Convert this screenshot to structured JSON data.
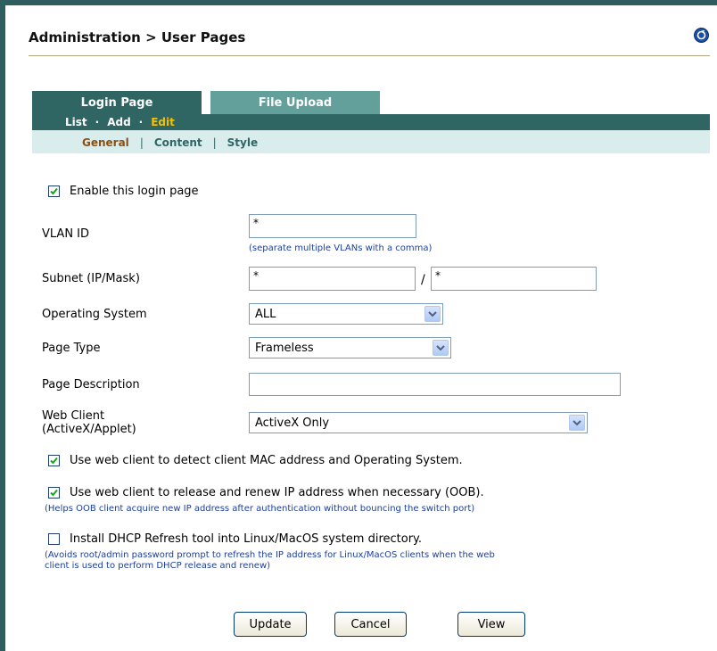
{
  "header": {
    "title": "Administration > User Pages"
  },
  "tabs": [
    {
      "label": "Login Page",
      "active": true
    },
    {
      "label": "File Upload",
      "active": false
    }
  ],
  "subnav": {
    "list": "List",
    "add": "Add",
    "edit": "Edit",
    "separator": "·"
  },
  "subsubnav": {
    "general": "General",
    "content": "Content",
    "style": "Style",
    "separator": "|"
  },
  "form": {
    "enable": {
      "label": "Enable this login page",
      "checked": true
    },
    "vlan": {
      "label": "VLAN ID",
      "value": "*",
      "hint": "(separate multiple VLANs with a comma)"
    },
    "subnet": {
      "label": "Subnet (IP/Mask)",
      "ip": "*",
      "mask": "*",
      "slash": "/"
    },
    "os": {
      "label": "Operating System",
      "value": "ALL"
    },
    "page_type": {
      "label": "Page Type",
      "value": "Frameless"
    },
    "page_desc": {
      "label": "Page Description",
      "value": ""
    },
    "web_client": {
      "label_line1": "Web Client",
      "label_line2": "(ActiveX/Applet)",
      "value": "ActiveX Only"
    },
    "detect_mac": {
      "label": "Use web client to detect client MAC address and Operating System.",
      "checked": true
    },
    "release_renew": {
      "label": "Use web client to release and renew IP address when necessary (OOB).",
      "checked": true,
      "hint": "(Helps OOB client acquire new IP address after authentication without bouncing the switch port)"
    },
    "dhcp_tool": {
      "label": "Install DHCP Refresh tool into Linux/MacOS system directory.",
      "checked": false,
      "hint_line1": "(Avoids root/admin password prompt to refresh the IP address for Linux/MacOS clients when the web",
      "hint_line2": "client is used to perform DHCP release and renew)"
    }
  },
  "buttons": {
    "update": "Update",
    "cancel": "Cancel",
    "view": "View"
  },
  "colors": {
    "tab_dark": "#2f6563",
    "tab_light": "#64a09b",
    "subnav_bg": "#d9eeec",
    "active_edit": "#f2c200",
    "hint": "#1b3fa0"
  }
}
